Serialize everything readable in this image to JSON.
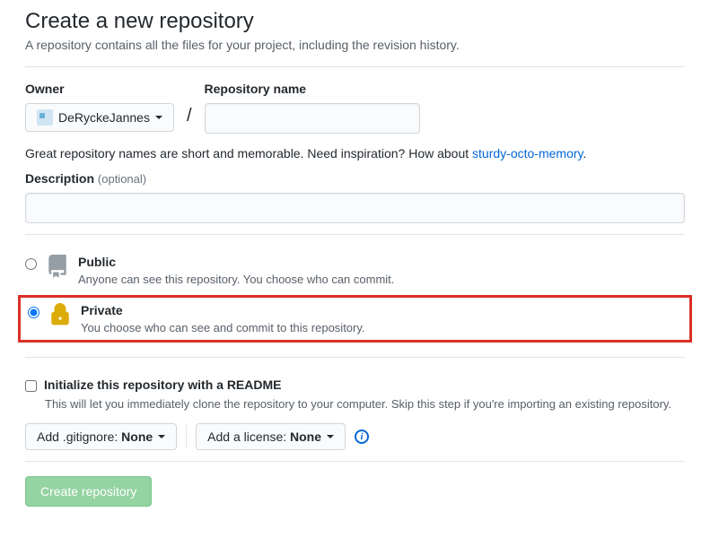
{
  "header": {
    "title": "Create a new repository",
    "subtitle": "A repository contains all the files for your project, including the revision history."
  },
  "owner": {
    "label": "Owner",
    "selected": "DeRyckeJannes"
  },
  "repo_name": {
    "label": "Repository name",
    "value": ""
  },
  "tip": {
    "prefix": "Great repository names are short and memorable. Need inspiration? How about ",
    "suggestion": "sturdy-octo-memory",
    "suffix": "."
  },
  "description": {
    "label": "Description",
    "optional": "(optional)",
    "value": ""
  },
  "visibility": {
    "public": {
      "title": "Public",
      "desc": "Anyone can see this repository. You choose who can commit."
    },
    "private": {
      "title": "Private",
      "desc": "You choose who can see and commit to this repository."
    }
  },
  "init_readme": {
    "label": "Initialize this repository with a README",
    "desc": "This will let you immediately clone the repository to your computer. Skip this step if you're importing an existing repository."
  },
  "gitignore": {
    "label_prefix": "Add .gitignore: ",
    "value": "None"
  },
  "license": {
    "label_prefix": "Add a license: ",
    "value": "None"
  },
  "submit": {
    "label": "Create repository"
  }
}
